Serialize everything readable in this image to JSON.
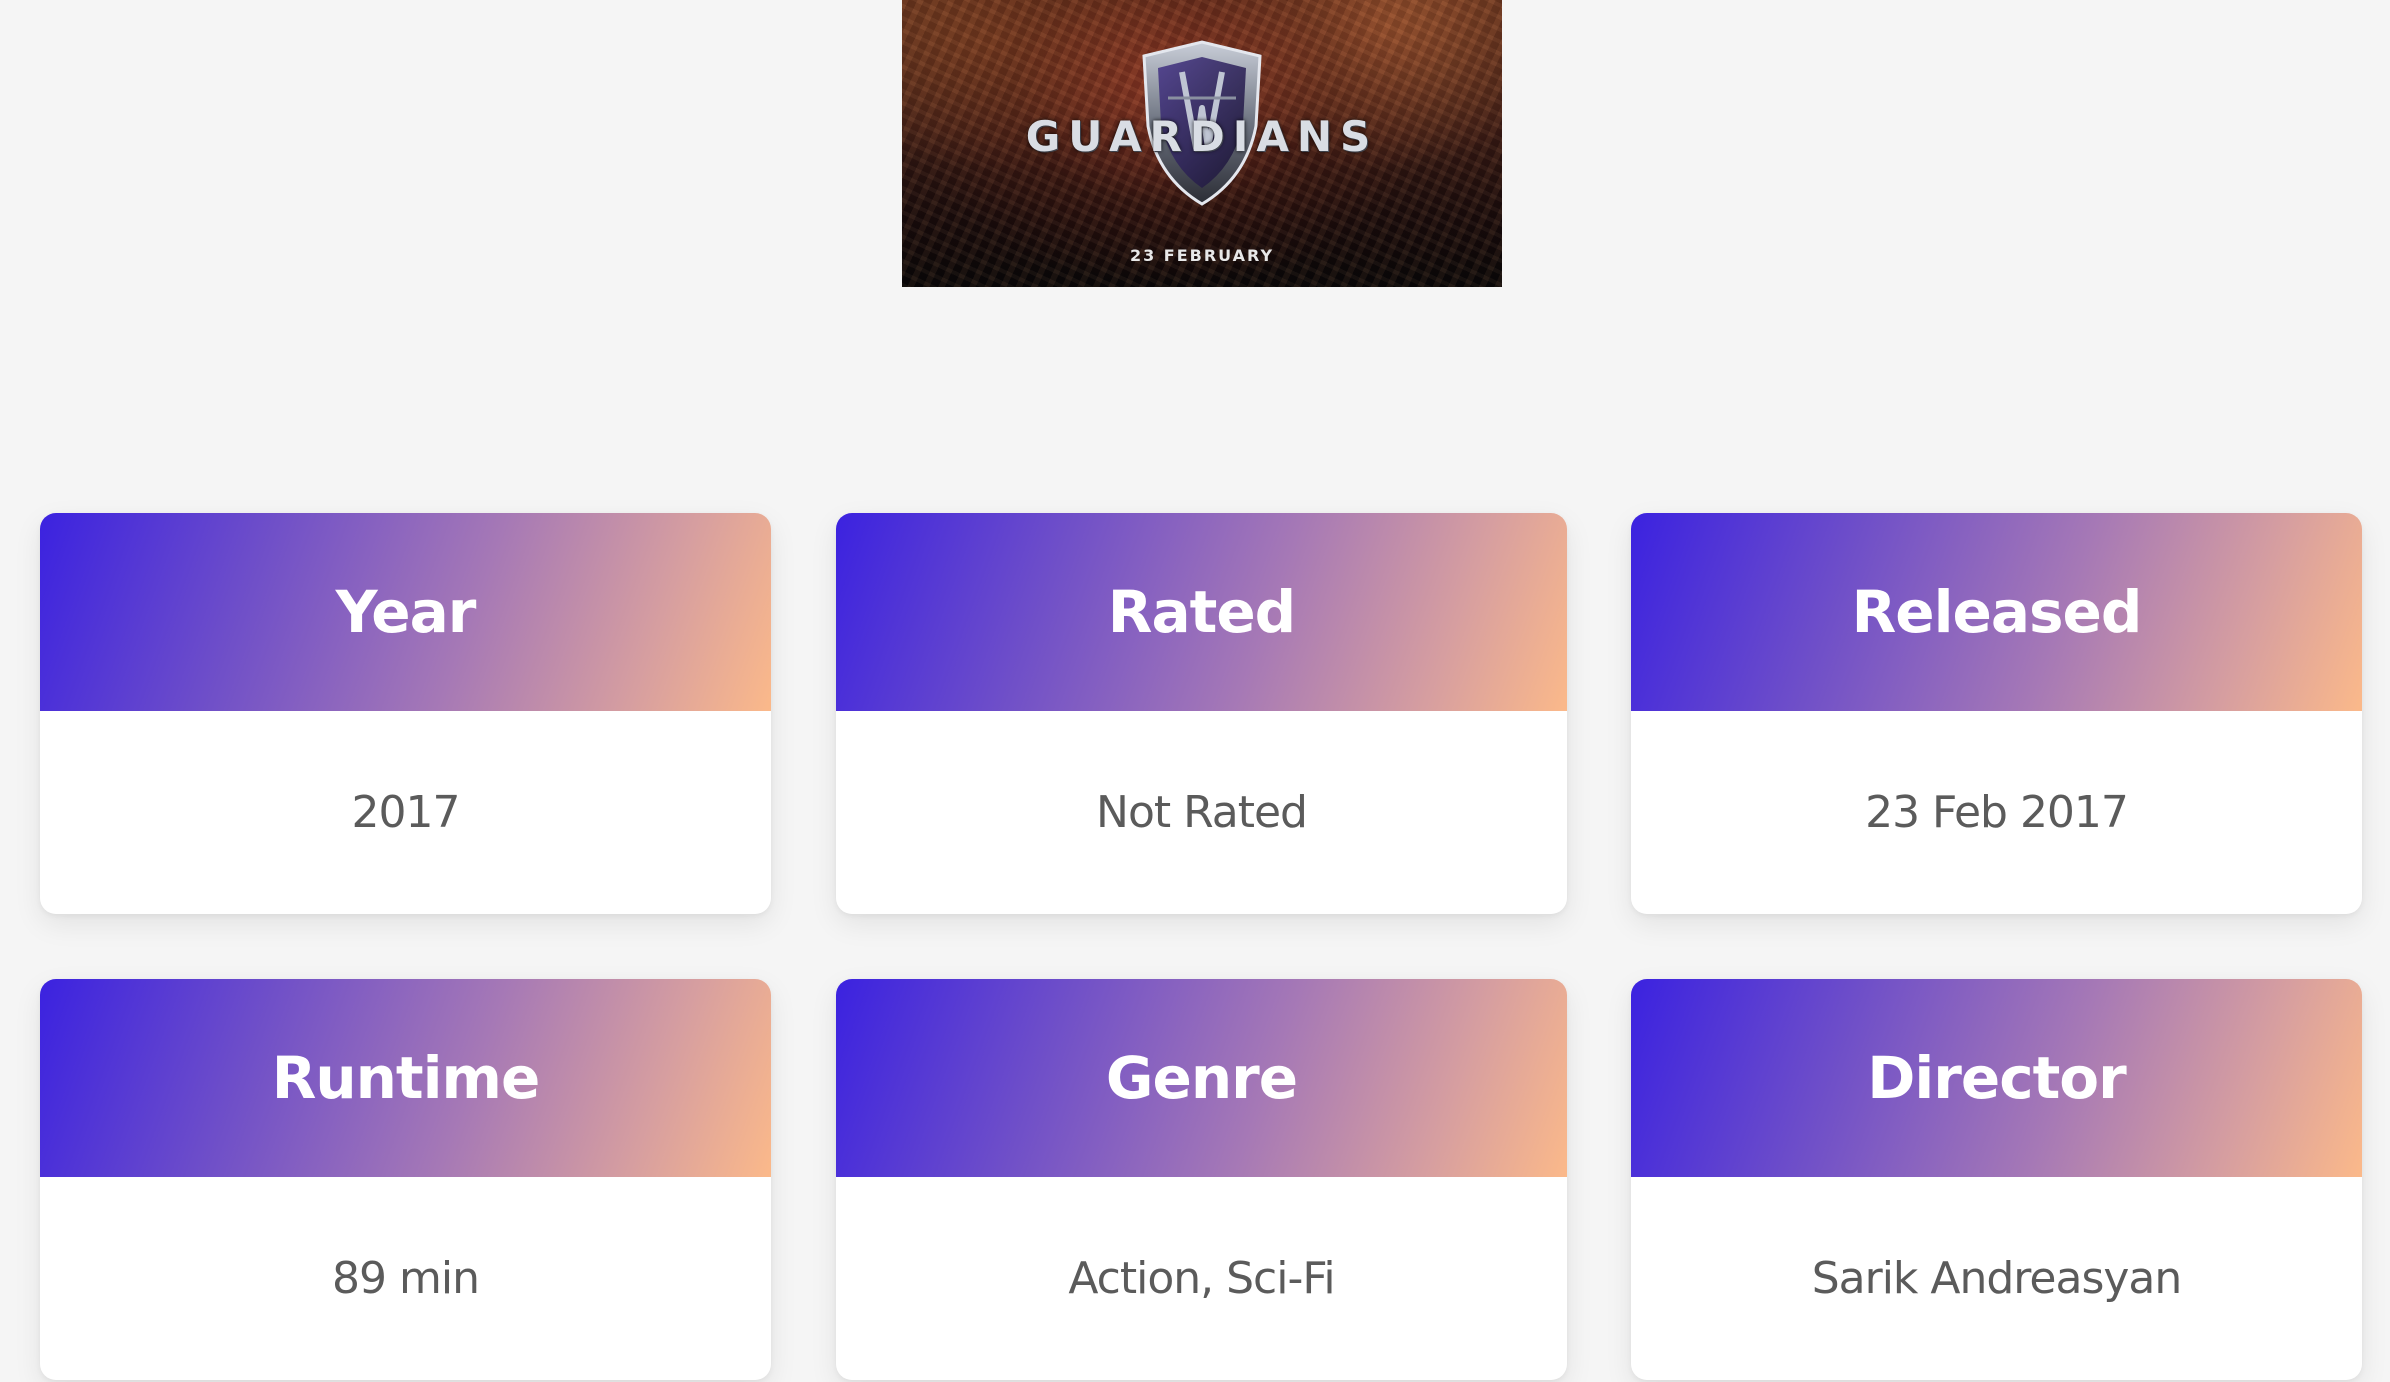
{
  "poster": {
    "title": "GUARDIANS",
    "date": "23 FEBRUARY"
  },
  "details": [
    {
      "label": "Year",
      "value": "2017"
    },
    {
      "label": "Rated",
      "value": "Not Rated"
    },
    {
      "label": "Released",
      "value": "23 Feb 2017"
    },
    {
      "label": "Runtime",
      "value": "89 min"
    },
    {
      "label": "Genre",
      "value": "Action, Sci-Fi"
    },
    {
      "label": "Director",
      "value": "Sarik Andreasyan"
    }
  ],
  "colors": {
    "page_background": "#f5f5f5",
    "header_gradient_start": "#3b22e0",
    "header_gradient_end": "#fbb98a",
    "value_text": "#5b5b5b"
  }
}
